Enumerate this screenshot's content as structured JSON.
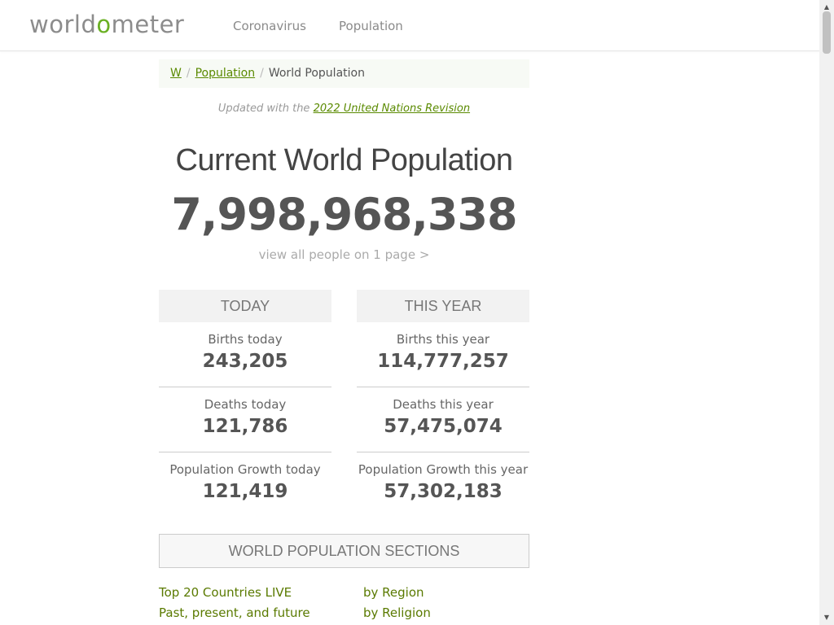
{
  "header": {
    "logo_pre": "world",
    "logo_o": "o",
    "logo_post": "meter",
    "nav": [
      "Coronavirus",
      "Population"
    ]
  },
  "breadcrumb": {
    "home": "W",
    "section": "Population",
    "current": "World Population"
  },
  "updated": {
    "prefix": "Updated with the",
    "link": "2022 United Nations Revision"
  },
  "title": "Current World Population",
  "counter": "7,998,968,338",
  "view_all": "view all people on 1 page >",
  "today": {
    "header": "TODAY",
    "stats": [
      {
        "label": "Births today",
        "value": "243,205"
      },
      {
        "label": "Deaths today",
        "value": "121,786"
      },
      {
        "label": "Population Growth today",
        "value": "121,419"
      }
    ]
  },
  "this_year": {
    "header": "THIS YEAR",
    "stats": [
      {
        "label": "Births this year",
        "value": "114,777,257"
      },
      {
        "label": "Deaths this year",
        "value": "57,475,074"
      },
      {
        "label": "Population Growth this year",
        "value": "57,302,183"
      }
    ]
  },
  "sections": {
    "header": "WORLD POPULATION SECTIONS",
    "links": [
      "Top 20 Countries LIVE",
      "Past, present, and future",
      "by Region",
      "by Religion"
    ]
  },
  "colors": {
    "accent": "#6ab023",
    "link": "#5a8a00"
  }
}
